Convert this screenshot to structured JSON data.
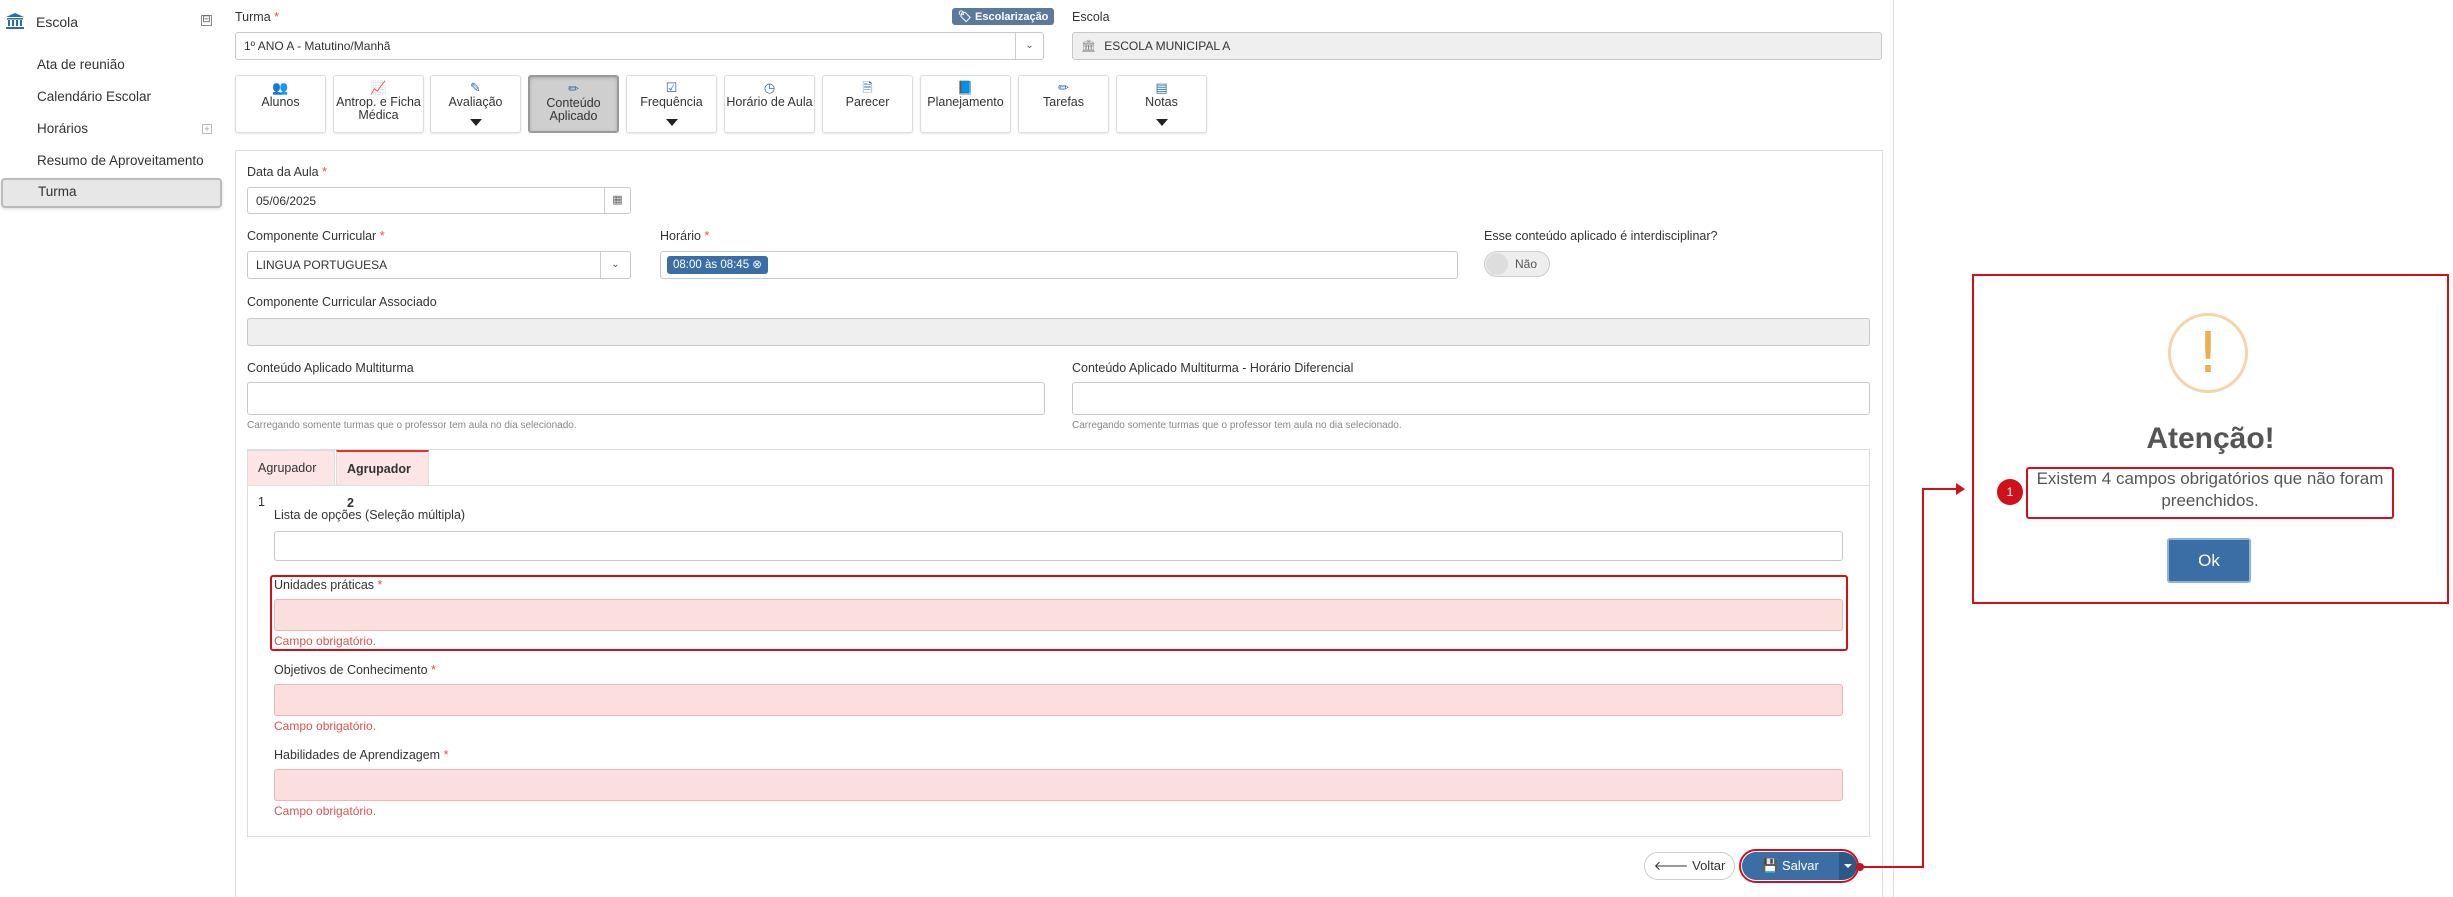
{
  "sidebar": {
    "section_title": "Escola",
    "collapse_symbol": "⊟",
    "items": [
      {
        "label": "Ata de reunião"
      },
      {
        "label": "Calendário Escolar"
      },
      {
        "label": "Horários",
        "expand_symbol": "+"
      },
      {
        "label": "Resumo de Aproveitamento"
      },
      {
        "label": "Turma"
      }
    ]
  },
  "header": {
    "turma_label": "Turma",
    "turma_value": "1º ANO A - Matutino/Manhã",
    "badge": "Escolarização",
    "escola_label": "Escola",
    "escola_value": "ESCOLA MUNICIPAL A"
  },
  "toolbar": [
    {
      "label": "Alunos",
      "icon": "users-icon"
    },
    {
      "label": "Antrop. e Ficha Médica",
      "icon": "chart-line-icon"
    },
    {
      "label": "Avaliação",
      "icon": "edit-icon"
    },
    {
      "label": "Conteúdo Aplicado",
      "icon": "pencil-icon"
    },
    {
      "label": "Frequência",
      "icon": "checkbox-icon"
    },
    {
      "label": "Horário de Aula",
      "icon": "clock-icon"
    },
    {
      "label": "Parecer",
      "icon": "document-icon"
    },
    {
      "label": "Planejamento",
      "icon": "book-icon"
    },
    {
      "label": "Tarefas",
      "icon": "pencil-icon"
    },
    {
      "label": "Notas",
      "icon": "calendar-icon"
    }
  ],
  "form": {
    "data_aula_label": "Data da Aula",
    "data_aula_value": "05/06/2025",
    "componente_label": "Componente Curricular",
    "componente_value": "LINGUA PORTUGUESA",
    "horario_label": "Horário",
    "horario_chip": "08:00 às 08:45",
    "interdisciplinar_label": "Esse conteúdo aplicado é interdisciplinar?",
    "interdisciplinar_value": "Não",
    "associado_label": "Componente Curricular Associado",
    "multiturma_label": "Conteúdo Aplicado Multiturma",
    "multiturma_hint": "Carregando somente turmas que o professor tem aula no dia selecionado.",
    "multiturma_dif_label": "Conteúdo Aplicado Multiturma - Horário Diferencial",
    "multiturma_dif_hint": "Carregando somente turmas que o professor tem aula no dia selecionado.",
    "tabs": [
      {
        "label": "Agrupador 1"
      },
      {
        "label": "Agrupador 2"
      }
    ],
    "lista_label": "Lista de opções (Seleção múltipla)",
    "unidades_label": "Unidades práticas",
    "objetivos_label": "Objetivos de Conhecimento",
    "habilidades_label": "Habilidades de Aprendizagem",
    "required_error": "Campo obrigatório.",
    "required_mark": "*"
  },
  "actions": {
    "voltar": "Voltar",
    "salvar": "Salvar"
  },
  "modal": {
    "icon": "!",
    "title": "Atenção!",
    "message": "Existem 4 campos obrigatórios que não foram preenchidos.",
    "ok": "Ok",
    "annotation_number": "1"
  }
}
